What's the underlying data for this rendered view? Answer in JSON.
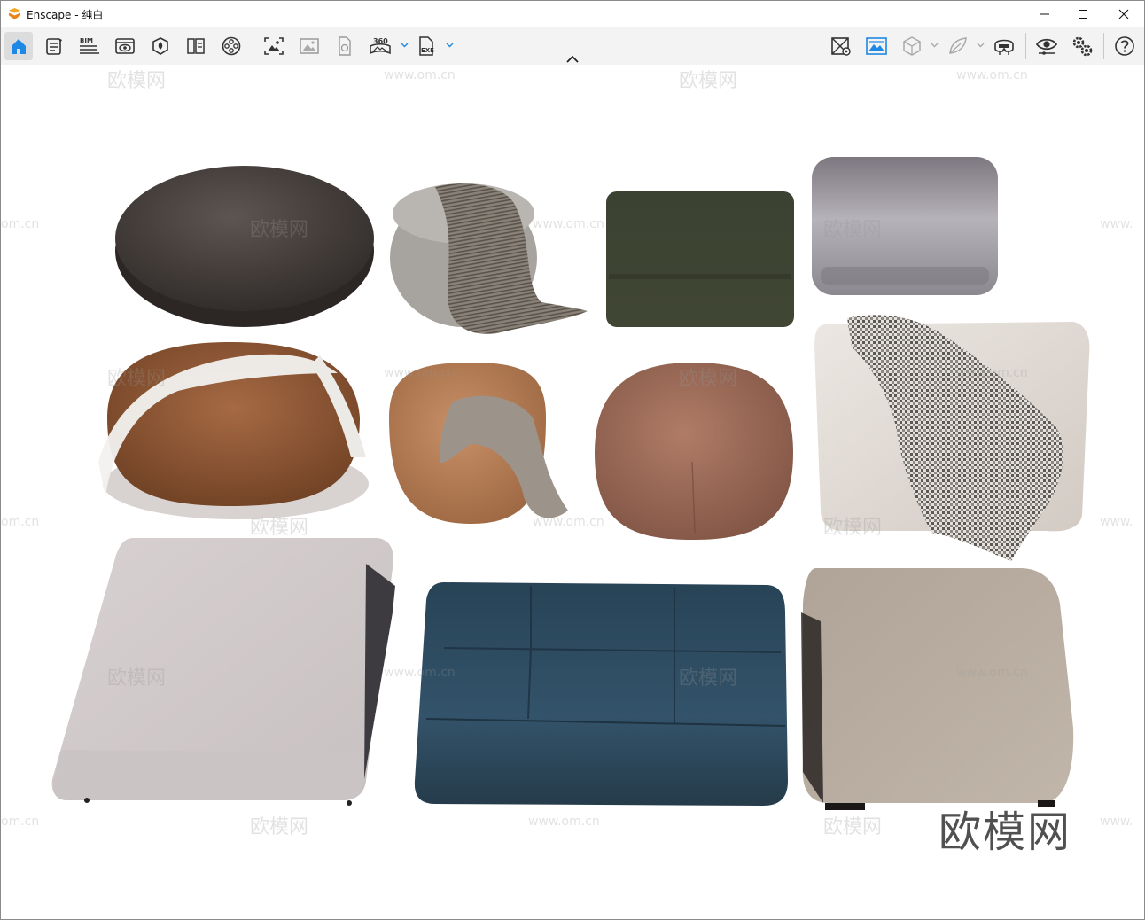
{
  "window": {
    "title": "Enscape - 纯白",
    "controls": [
      "minimize",
      "maximize",
      "close"
    ]
  },
  "toolbar": {
    "left_icons": [
      "home-icon",
      "notes-icon",
      "bim-icon",
      "view-icon",
      "material-icon",
      "book-icon",
      "video-icon",
      "screenshot-icon",
      "image-icon",
      "panorama-file-icon",
      "panorama-360-icon",
      "exe-export-icon"
    ],
    "right_icons": [
      "map-icon",
      "landscape-icon",
      "cube-icon",
      "leaf-icon",
      "vr-headset-icon",
      "visual-settings-icon",
      "settings-icon",
      "help-icon"
    ],
    "labels": {
      "bim": "BIM",
      "pano": "360",
      "exe": "EXE"
    }
  },
  "viewport": {
    "background": "#ffffff",
    "watermark_text": "欧模网",
    "watermark_url": "www.om.cn",
    "partial_url_left": "om.cn",
    "partial_url_right": "www.",
    "big_watermark": "欧模网"
  },
  "scene": {
    "objects": [
      "round-dark-ottoman",
      "fabric-pouf-with-throw",
      "green-velvet-ottoman",
      "grey-gradient-ottoman",
      "leather-pouf-with-white-throw",
      "tan-leather-pouf-with-throw",
      "brown-leather-pouf",
      "cream-ottoman-with-plaid-throw",
      "white-fabric-ottoman",
      "blue-tufted-leather-ottoman",
      "taupe-fabric-ottoman"
    ],
    "colors": {
      "dark_brown": "#4a4340",
      "green": "#3e4433",
      "grey": "#9a969b",
      "cognac": "#8a5533",
      "tan": "#b07a52",
      "brown": "#9b6a56",
      "cream": "#e2dcd6",
      "white_fabric": "#d6d0ce",
      "navy": "#2b4456",
      "taupe": "#b5a89b"
    }
  }
}
